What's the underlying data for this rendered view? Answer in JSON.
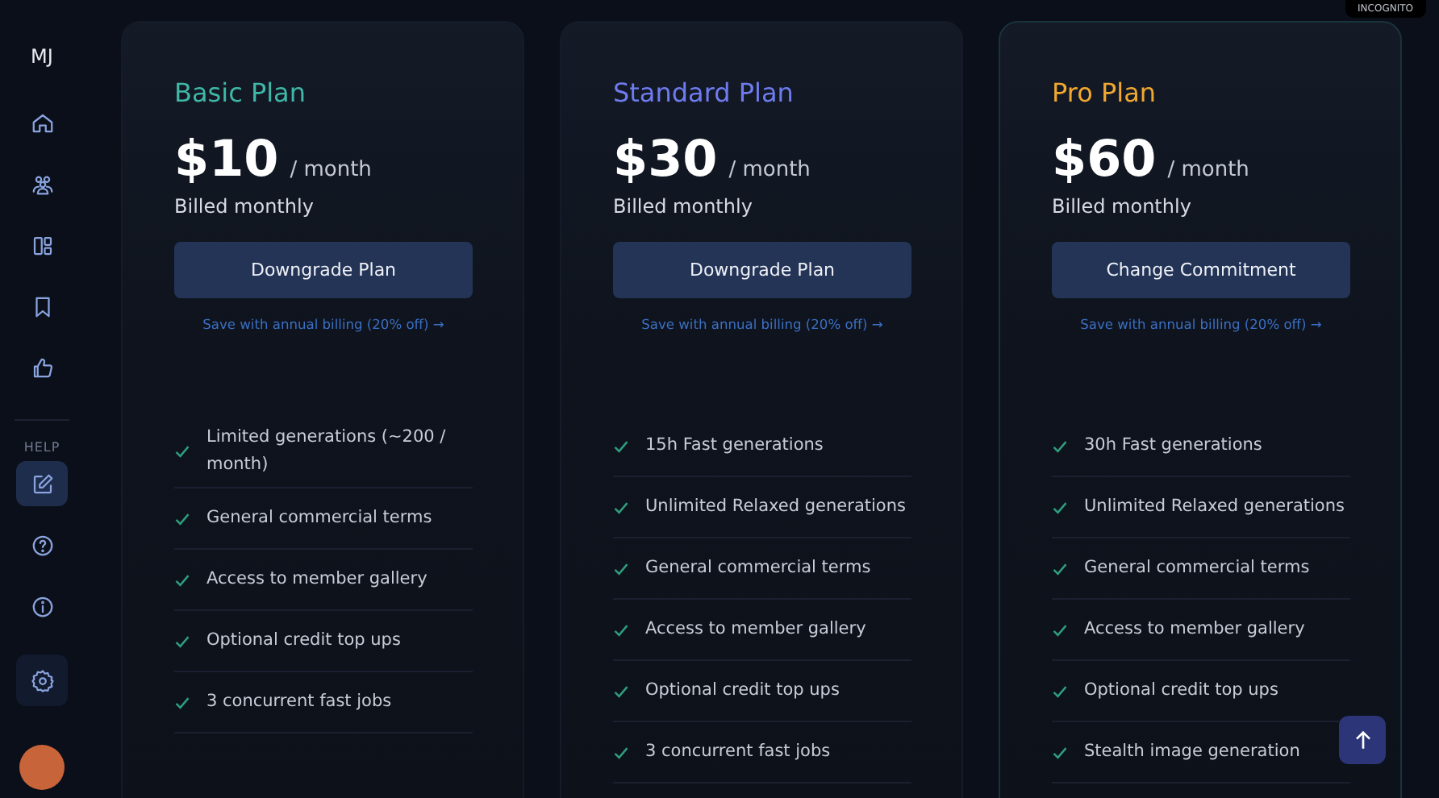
{
  "sidebar": {
    "logo": "MJ",
    "nav": [
      {
        "kind": "home",
        "selected": false
      },
      {
        "kind": "community",
        "selected": false
      },
      {
        "kind": "layout",
        "selected": false
      },
      {
        "kind": "bookmark",
        "selected": false
      },
      {
        "kind": "like",
        "selected": false
      }
    ],
    "help_label": "HELP",
    "help": [
      {
        "kind": "edit",
        "selected": true
      },
      {
        "kind": "question",
        "selected": false
      },
      {
        "kind": "info",
        "selected": false
      }
    ]
  },
  "badge": "INCOGNITO",
  "plans": [
    {
      "name": "Basic Plan",
      "color": "#3fb8a8",
      "current": false,
      "price": "$10",
      "period": "/ month",
      "billing": "Billed monthly",
      "button": "Downgrade Plan",
      "annual_link": "Save with annual billing (20% off) →",
      "features": [
        "Limited generations (~200 / month)",
        "General commercial terms",
        "Access to member gallery",
        "Optional credit top ups",
        "3 concurrent fast jobs"
      ]
    },
    {
      "name": "Standard Plan",
      "color": "#6f7cf0",
      "current": false,
      "price": "$30",
      "period": "/ month",
      "billing": "Billed monthly",
      "button": "Downgrade Plan",
      "annual_link": "Save with annual billing (20% off) →",
      "features": [
        "15h Fast generations",
        "Unlimited Relaxed generations",
        "General commercial terms",
        "Access to member gallery",
        "Optional credit top ups",
        "3 concurrent fast jobs"
      ]
    },
    {
      "name": "Pro Plan",
      "color": "#f0a830",
      "current": true,
      "price": "$60",
      "period": "/ month",
      "billing": "Billed monthly",
      "button": "Change Commitment",
      "annual_link": "Save with annual billing (20% off) →",
      "features": [
        "30h Fast generations",
        "Unlimited Relaxed generations",
        "General commercial terms",
        "Access to member gallery",
        "Optional credit top ups",
        "Stealth image generation"
      ]
    }
  ]
}
